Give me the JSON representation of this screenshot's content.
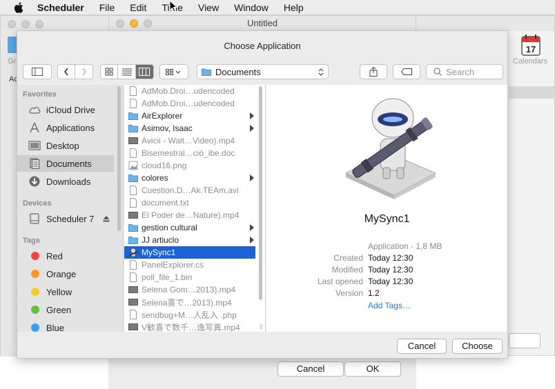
{
  "menubar": {
    "app_name": "Scheduler",
    "items": [
      "File",
      "Edit",
      "Time",
      "View",
      "Window",
      "Help"
    ]
  },
  "background_window": {
    "left_label": "Gr",
    "left_label2": "Ac",
    "calendar_day": "17",
    "calendars_label": "Calendars"
  },
  "untitled_window": {
    "title": "Untitled",
    "cancel_label": "Cancel",
    "ok_label": "OK"
  },
  "dialog": {
    "title": "Choose Application",
    "toolbar": {
      "location": "Documents",
      "search_placeholder": "Search"
    },
    "sidebar": {
      "favorites_header": "Favorites",
      "favorites": [
        {
          "label": "iCloud Drive",
          "icon": "cloud-icon"
        },
        {
          "label": "Applications",
          "icon": "applications-icon"
        },
        {
          "label": "Desktop",
          "icon": "desktop-icon"
        },
        {
          "label": "Documents",
          "icon": "documents-icon",
          "selected": true
        },
        {
          "label": "Downloads",
          "icon": "downloads-icon"
        }
      ],
      "devices_header": "Devices",
      "devices": [
        {
          "label": "Scheduler 7",
          "icon": "disk-icon"
        }
      ],
      "tags_header": "Tags",
      "tags": [
        {
          "label": "Red",
          "color": "#f0483e"
        },
        {
          "label": "Orange",
          "color": "#f59a23"
        },
        {
          "label": "Yellow",
          "color": "#f4cd2a"
        },
        {
          "label": "Green",
          "color": "#5fc23d"
        },
        {
          "label": "Blue",
          "color": "#3d9cf0"
        }
      ]
    },
    "files": [
      {
        "name": "AdMob.Droi…udencoded",
        "kind": "doc"
      },
      {
        "name": "AdMob.Droi…udencoded",
        "kind": "doc"
      },
      {
        "name": "AirExplorer",
        "kind": "folder"
      },
      {
        "name": "Asimov, Isaac",
        "kind": "folder"
      },
      {
        "name": "Avicii - Wait…Video).mp4",
        "kind": "video"
      },
      {
        "name": "Bisemestral…ció_ibe.doc",
        "kind": "doc"
      },
      {
        "name": "cloud16.png",
        "kind": "image"
      },
      {
        "name": "colores",
        "kind": "folder"
      },
      {
        "name": "Cuestion.D…Ak.TEAm.avi",
        "kind": "doc"
      },
      {
        "name": "document.txt",
        "kind": "doc"
      },
      {
        "name": "El Poder de…Nature).mp4",
        "kind": "video"
      },
      {
        "name": "gestion cultural",
        "kind": "folder"
      },
      {
        "name": "JJ artiuclo",
        "kind": "folder"
      },
      {
        "name": "MySync1",
        "kind": "app",
        "selected": true
      },
      {
        "name": "PanelExplorer.cs",
        "kind": "doc"
      },
      {
        "name": "poll_file_1.bin",
        "kind": "doc"
      },
      {
        "name": "Selena Gom…2013).mp4",
        "kind": "video"
      },
      {
        "name": "Selena喜で…2013).mp4",
        "kind": "video"
      },
      {
        "name": "sendbug+M…人乱入 .php",
        "kind": "doc"
      },
      {
        "name": "V歓喜で数千…逸写真.mp4",
        "kind": "video"
      }
    ],
    "preview": {
      "name": "MySync1",
      "kind_size": "Application - 1,8 MB",
      "created_label": "Created",
      "created_value": "Today 12:30",
      "modified_label": "Modified",
      "modified_value": "Today 12:30",
      "last_opened_label": "Last opened",
      "last_opened_value": "Today 12:30",
      "version_label": "Version",
      "version_value": "1.2",
      "add_tags_label": "Add Tags…"
    },
    "cancel_label": "Cancel",
    "choose_label": "Choose"
  }
}
